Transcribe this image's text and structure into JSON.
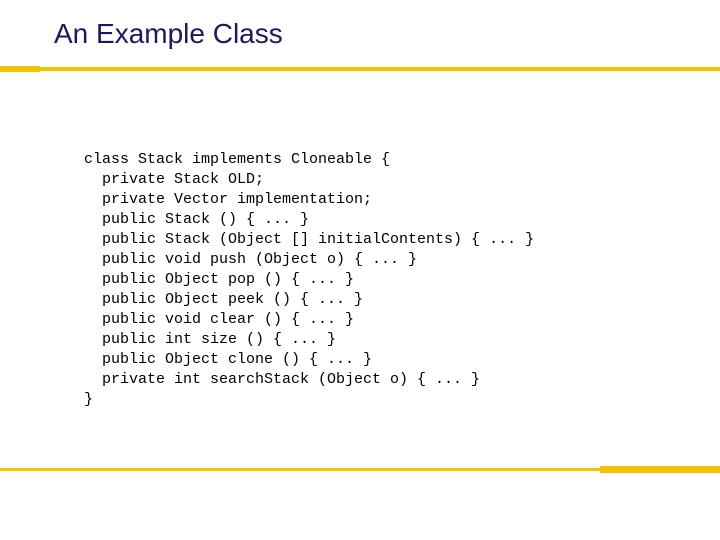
{
  "title": "An Example Class",
  "code": {
    "l0": "class Stack implements Cloneable {",
    "l1": "private Stack OLD;",
    "l2": "private Vector implementation;",
    "l3": "public Stack () { ... }",
    "l4": "public Stack (Object [] initialContents) { ... }",
    "l5": "public void push (Object o) { ... }",
    "l6": "public Object pop () { ... }",
    "l7": "public Object peek () { ... }",
    "l8": "public void clear () { ... }",
    "l9": "public int size () { ... }",
    "l10": "public Object clone () { ... }",
    "l11": "private int searchStack (Object o) { ... }",
    "l12": "}"
  }
}
